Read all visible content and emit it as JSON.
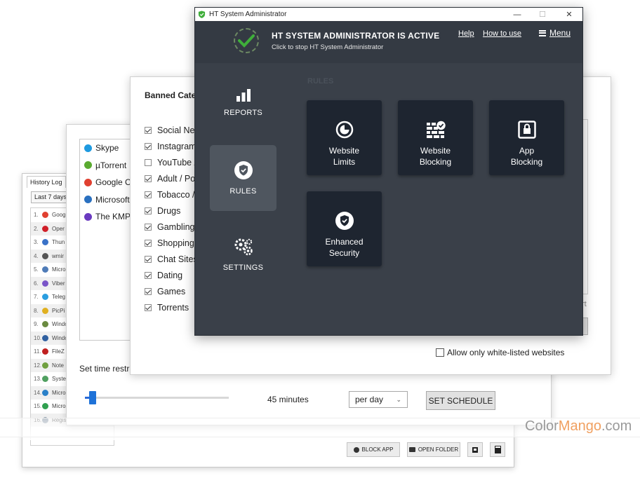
{
  "history_window": {
    "tab_label": "History Log",
    "range_value": "Last 7 days",
    "rows": [
      {
        "num": "1.",
        "name": "Goog",
        "color": "#e04030"
      },
      {
        "num": "2.",
        "name": "Oper",
        "color": "#d0202a"
      },
      {
        "num": "3.",
        "name": "Thun",
        "color": "#3a72c8"
      },
      {
        "num": "4.",
        "name": "wmir",
        "color": "#555555"
      },
      {
        "num": "5.",
        "name": "Micro",
        "color": "#4f7cb8"
      },
      {
        "num": "6.",
        "name": "Viber",
        "color": "#7a55c8"
      },
      {
        "num": "7.",
        "name": "Teleg",
        "color": "#2a9ee0"
      },
      {
        "num": "8.",
        "name": "PicPi",
        "color": "#e0b020"
      },
      {
        "num": "9.",
        "name": "Windo",
        "color": "#6a8a40"
      },
      {
        "num": "10.",
        "name": "Windo",
        "color": "#3060a0"
      },
      {
        "num": "11.",
        "name": "FileZ",
        "color": "#c02020"
      },
      {
        "num": "12.",
        "name": "Note",
        "color": "#70a040"
      },
      {
        "num": "13.",
        "name": "Syste",
        "color": "#50a060"
      },
      {
        "num": "14.",
        "name": "Micro",
        "color": "#2a80c8"
      },
      {
        "num": "15.",
        "name": "Micro",
        "color": "#30a050"
      },
      {
        "num": "16.",
        "name": "Regis",
        "color": "#8090a0"
      }
    ],
    "buttons": {
      "block_app": "BLOCK APP",
      "open_folder": "OPEN FOLDER"
    }
  },
  "time_window": {
    "apps": [
      {
        "name": "Skype",
        "color": "#1e9ae0"
      },
      {
        "name": "µTorrent",
        "color": "#5aaa30"
      },
      {
        "name": "Google Ch",
        "color": "#e04030"
      },
      {
        "name": "Microsoft",
        "color": "#2a70c0"
      },
      {
        "name": "The KMPl",
        "color": "#6a3ac0"
      }
    ],
    "time_label": "Set time restri",
    "slider_value_minutes": 45,
    "minutes_text": "45 minutes",
    "period_select": "per day",
    "set_schedule": "SET SCHEDULE"
  },
  "category_window": {
    "title": "Banned Categ",
    "categories": [
      {
        "label": "Social Net",
        "checked": true
      },
      {
        "label": "Instagram",
        "checked": true
      },
      {
        "label": "YouTube /",
        "checked": false
      },
      {
        "label": "Adult / Po",
        "checked": true
      },
      {
        "label": "Tobacco /",
        "checked": true
      },
      {
        "label": "Drugs",
        "checked": true
      },
      {
        "label": "Gambling",
        "checked": true
      },
      {
        "label": "Shopping",
        "checked": true
      },
      {
        "label": "Chat Sites",
        "checked": true
      },
      {
        "label": "Dating",
        "checked": true
      },
      {
        "label": "Games",
        "checked": true
      },
      {
        "label": "Torrents",
        "checked": true
      }
    ],
    "whitelist_label": "Allow only white-listed websites",
    "whitelist_checked": false,
    "partial_link": "rt"
  },
  "main_window": {
    "title": "HT System Administrator",
    "controls": {
      "minimize": "—",
      "maximize": "☐",
      "close": "✕"
    },
    "status_title": "HT SYSTEM ADMINISTRATOR IS ACTIVE",
    "status_subtitle": "Click to stop HT System Administrator",
    "links": {
      "help": "Help",
      "how_to_use": "How to use",
      "menu": "Menu"
    },
    "sidebar": [
      {
        "label": "REPORTS",
        "icon": "bar-chart-icon",
        "active": false
      },
      {
        "label": "RULES",
        "icon": "shield-check-icon",
        "active": true
      },
      {
        "label": "SETTINGS",
        "icon": "gears-icon",
        "active": false
      }
    ],
    "section_ghost": "RULES",
    "tiles": [
      {
        "line1": "Website",
        "line2": "Limits",
        "icon": "clock-pie-icon"
      },
      {
        "line1": "Website",
        "line2": "Blocking",
        "icon": "brick-wall-check-icon"
      },
      {
        "line1": "App",
        "line2": "Blocking",
        "icon": "app-lock-icon"
      },
      {
        "line1": "Enhanced",
        "line2": "Security",
        "icon": "shield-check-icon"
      }
    ],
    "colors": {
      "panel": "#3a4049",
      "tile": "#1e2530",
      "active": "#4f565f",
      "status_check": "#3fae3a"
    }
  },
  "watermark": {
    "part1": "Color",
    "part2": "Mango",
    "part3": ".com"
  }
}
